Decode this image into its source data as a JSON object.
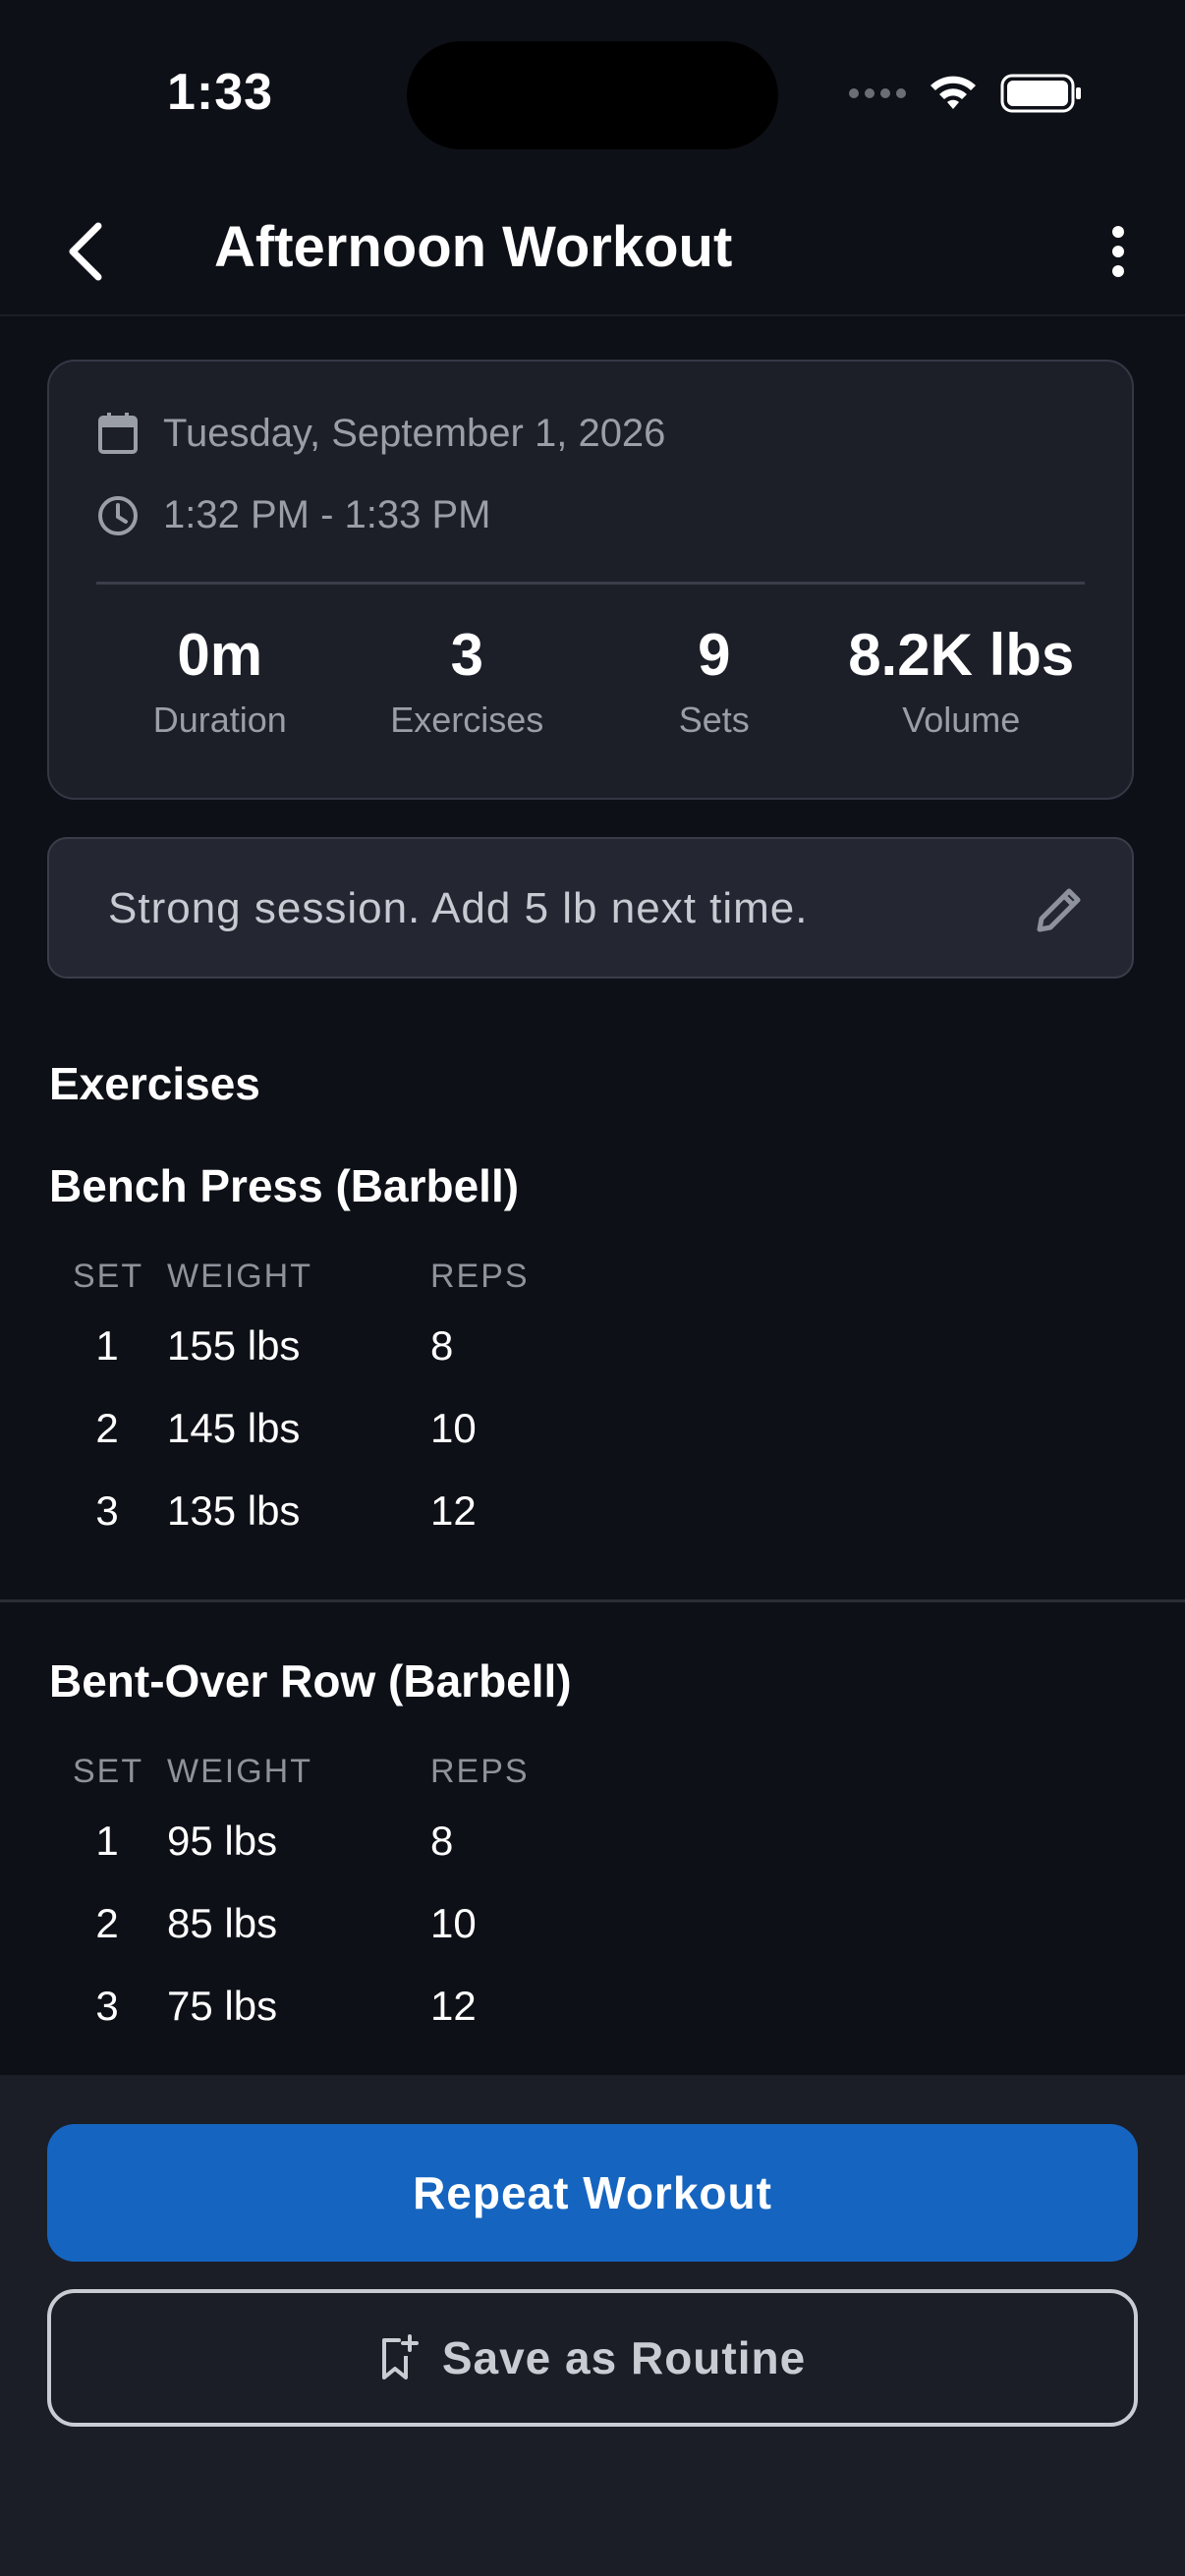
{
  "status_bar": {
    "time": "1:33"
  },
  "header": {
    "title": "Afternoon Workout"
  },
  "summary": {
    "date": "Tuesday, September 1, 2026",
    "time_range": "1:32 PM - 1:33 PM",
    "stats": [
      {
        "value": "0m",
        "label": "Duration"
      },
      {
        "value": "3",
        "label": "Exercises"
      },
      {
        "value": "9",
        "label": "Sets"
      },
      {
        "value": "8.2K lbs",
        "label": "Volume"
      }
    ]
  },
  "notes": {
    "text": "Strong session. Add 5 lb next time."
  },
  "exercises_section": {
    "title": "Exercises",
    "columns": {
      "set": "SET",
      "weight": "WEIGHT",
      "reps": "REPS"
    },
    "items": [
      {
        "name": "Bench Press (Barbell)",
        "sets": [
          {
            "set": "1",
            "weight": "155 lbs",
            "reps": "8"
          },
          {
            "set": "2",
            "weight": "145 lbs",
            "reps": "10"
          },
          {
            "set": "3",
            "weight": "135 lbs",
            "reps": "12"
          }
        ]
      },
      {
        "name": "Bent-Over Row (Barbell)",
        "sets": [
          {
            "set": "1",
            "weight": "95 lbs",
            "reps": "8"
          },
          {
            "set": "2",
            "weight": "85 lbs",
            "reps": "10"
          },
          {
            "set": "3",
            "weight": "75 lbs",
            "reps": "12"
          }
        ]
      }
    ]
  },
  "actions": {
    "repeat_label": "Repeat Workout",
    "save_label": "Save as Routine"
  },
  "icons": {
    "back": "chevron-left-icon",
    "more": "more-vertical-icon",
    "calendar": "calendar-icon",
    "clock": "clock-icon",
    "edit": "pencil-icon",
    "bookmark": "bookmark-add-icon"
  },
  "colors": {
    "background": "#0e1017",
    "card": "#1c1f28",
    "primary": "#1565c0",
    "muted_text": "#9a9ea7"
  }
}
